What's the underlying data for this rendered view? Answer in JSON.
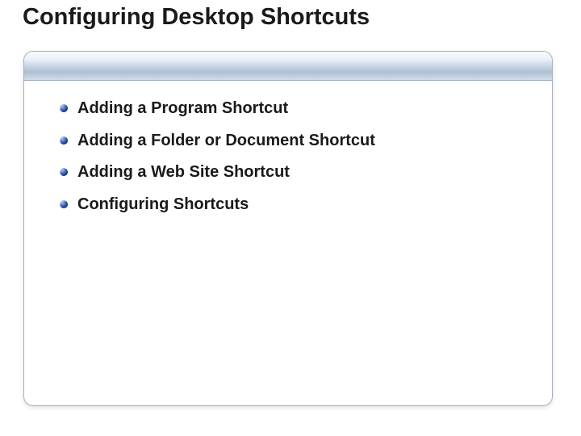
{
  "title": "Configuring Desktop Shortcuts",
  "bullets": [
    "Adding a Program Shortcut",
    "Adding a Folder or Document Shortcut",
    "Adding a Web Site Shortcut",
    "Configuring Shortcuts"
  ]
}
